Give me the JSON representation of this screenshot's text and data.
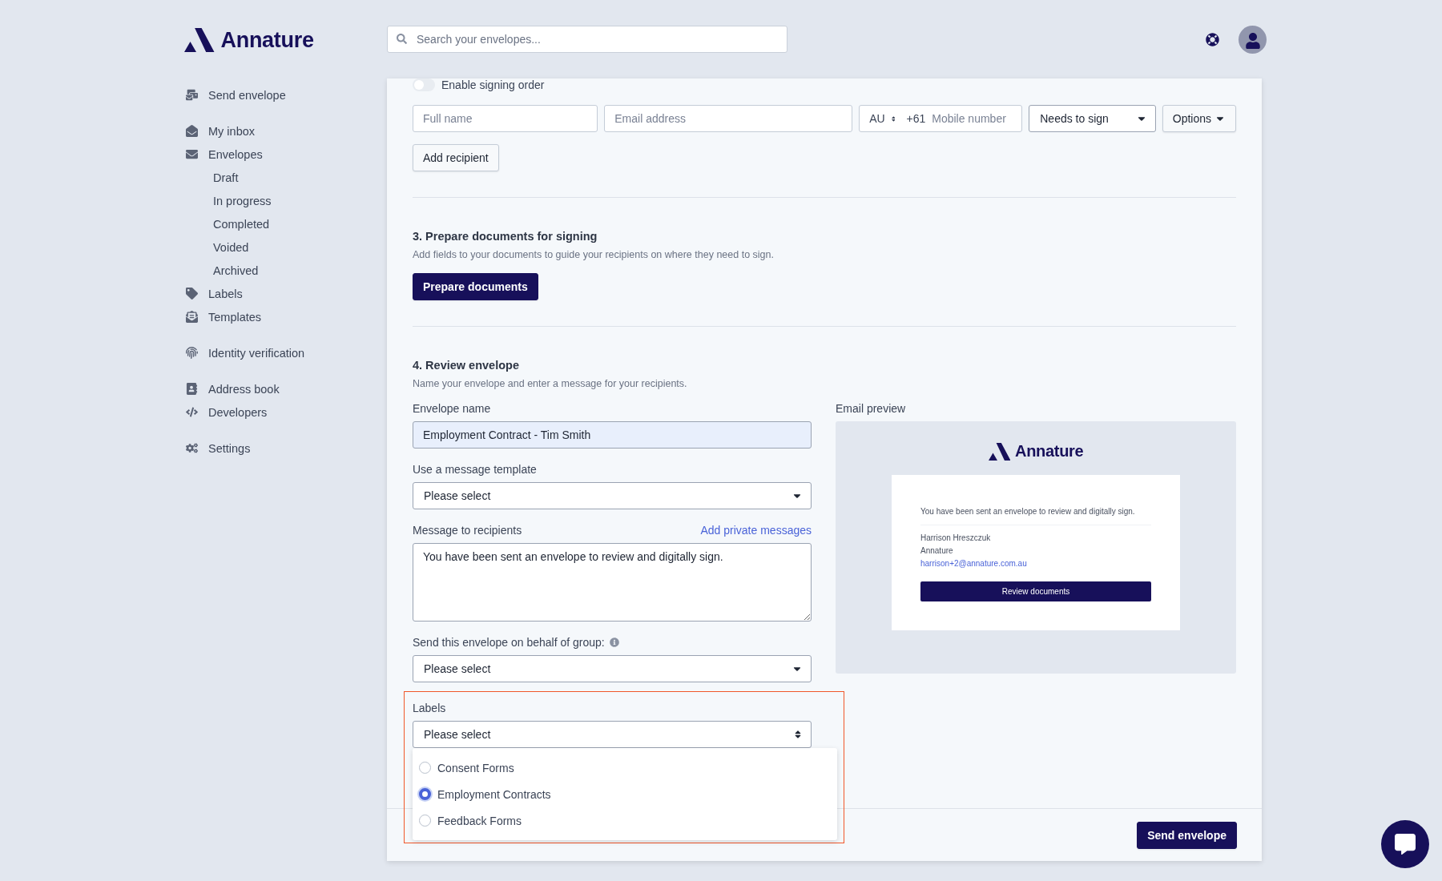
{
  "brand": {
    "name": "Annature"
  },
  "search": {
    "placeholder": "Search your envelopes..."
  },
  "sidebar": {
    "groups": [
      [
        {
          "label": "Send envelope"
        }
      ],
      [
        {
          "label": "My inbox"
        },
        {
          "label": "Envelopes",
          "children": [
            {
              "label": "Draft"
            },
            {
              "label": "In progress"
            },
            {
              "label": "Completed"
            },
            {
              "label": "Voided"
            },
            {
              "label": "Archived"
            }
          ]
        },
        {
          "label": "Labels"
        },
        {
          "label": "Templates"
        }
      ],
      [
        {
          "label": "Identity verification"
        }
      ],
      [
        {
          "label": "Address book"
        },
        {
          "label": "Developers"
        }
      ],
      [
        {
          "label": "Settings"
        }
      ]
    ]
  },
  "recipients": {
    "signing_order": {
      "label": "Enable signing order",
      "on": false
    },
    "full_name": {
      "placeholder": "Full name"
    },
    "email": {
      "placeholder": "Email address"
    },
    "phone": {
      "country": "AU",
      "dial_code": "+61",
      "placeholder": "Mobile number"
    },
    "role": {
      "value": "Needs to sign"
    },
    "options_button": "Options",
    "add_button": "Add recipient"
  },
  "prepare": {
    "title": "3. Prepare documents for signing",
    "description": "Add fields to your documents to guide your recipients on where they need to sign.",
    "button": "Prepare documents"
  },
  "review": {
    "title": "4. Review envelope",
    "description": "Name your envelope and enter a message for your recipients.",
    "envelope_name": {
      "label": "Envelope name",
      "value": "Employment Contract - Tim Smith"
    },
    "template": {
      "label": "Use a message template",
      "value": "Please select"
    },
    "message": {
      "label": "Message to recipients",
      "link": "Add private messages",
      "value": "You have been sent an envelope to review and digitally sign."
    },
    "group": {
      "label": "Send this envelope on behalf of group:",
      "value": "Please select"
    },
    "labels": {
      "label": "Labels",
      "value": "Please select",
      "highlighted": true,
      "options": [
        {
          "label": "Consent Forms",
          "selected": false
        },
        {
          "label": "Employment Contracts",
          "selected": true
        },
        {
          "label": "Feedback Forms",
          "selected": false
        }
      ]
    }
  },
  "email_preview": {
    "label": "Email preview",
    "brand": "Annature",
    "message": "You have been sent an envelope to review and digitally sign.",
    "sender_name": "Harrison Hreszczuk",
    "sender_org": "Annature",
    "sender_email": "harrison+2@annature.com.au",
    "button": "Review documents"
  },
  "footer": {
    "send_button": "Send envelope"
  }
}
